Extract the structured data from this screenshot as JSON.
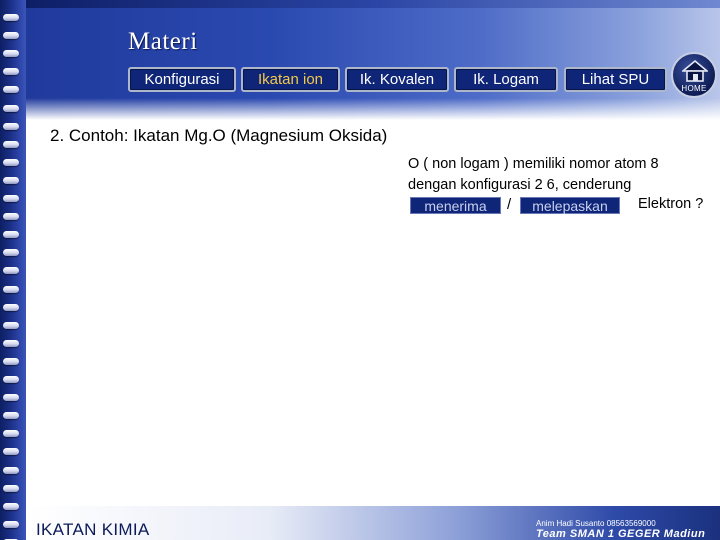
{
  "slide": {
    "title": "Materi",
    "footer_left": "IKATAN KIMIA",
    "credit": "Anim Hadi Susanto 08563569000",
    "team": "Team SMAN 1 GEGER Madiun"
  },
  "nav": {
    "tabs": [
      {
        "label": "Konfigurasi",
        "active": false
      },
      {
        "label": "Ikatan ion",
        "active": true
      },
      {
        "label": "Ik. Kovalen",
        "active": false
      },
      {
        "label": "Ik.  Logam",
        "active": false
      },
      {
        "label": "Lihat SPU",
        "active": false
      }
    ],
    "home_label": "HOME"
  },
  "content": {
    "heading": "2. Contoh: Ikatan Mg.O (Magnesium Oksida)",
    "line1": "O ( non logam ) memiliki nomor atom  8",
    "line2": "dengan konfigurasi  2 6, cenderung",
    "option1": "menerima",
    "separator": "/",
    "option2": "melepaskan",
    "tail": "Elektron ?"
  },
  "colors": {
    "tab_bg": "#0f2577",
    "active_tab_text": "#f3c94b",
    "header": "#2a49b0"
  }
}
